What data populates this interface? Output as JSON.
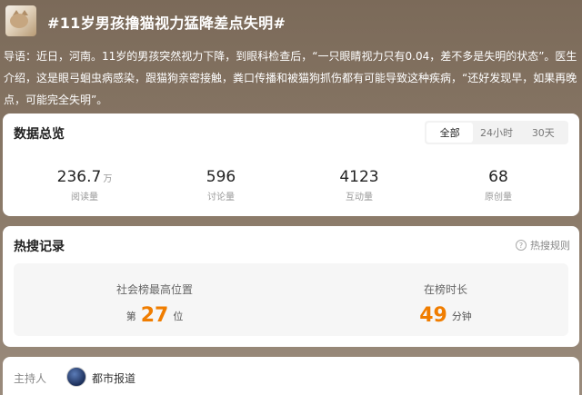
{
  "header": {
    "title": "#11岁男孩撸猫视力猛降差点失明#",
    "intro": "导语：近日，河南。11岁的男孩突然视力下降，到眼科检查后，“一只眼睛视力只有0.04，差不多是失明的状态”。医生介绍，这是眼弓蛔虫病感染，跟猫狗亲密接触，粪口传播和被猫狗抓伤都有可能导致这种疾病，“还好发现早，如果再晚点，可能完全失明”。"
  },
  "overview": {
    "title": "数据总览",
    "tabs": [
      "全部",
      "24小时",
      "30天"
    ],
    "active_tab": "全部",
    "stats": [
      {
        "value": "236.7",
        "unit": "万",
        "label": "阅读量"
      },
      {
        "value": "596",
        "unit": "",
        "label": "讨论量"
      },
      {
        "value": "4123",
        "unit": "",
        "label": "互动量"
      },
      {
        "value": "68",
        "unit": "",
        "label": "原创量"
      }
    ]
  },
  "hot": {
    "title": "热搜记录",
    "rules_label": "热搜规则",
    "rank": {
      "label": "社会榜最高位置",
      "prefix": "第",
      "value": "27",
      "suffix": "位"
    },
    "duration": {
      "label": "在榜时长",
      "value": "49",
      "suffix": "分钟"
    }
  },
  "host": {
    "label": "主持人",
    "name": "都市报道"
  },
  "colors": {
    "accent": "#f07d00"
  }
}
